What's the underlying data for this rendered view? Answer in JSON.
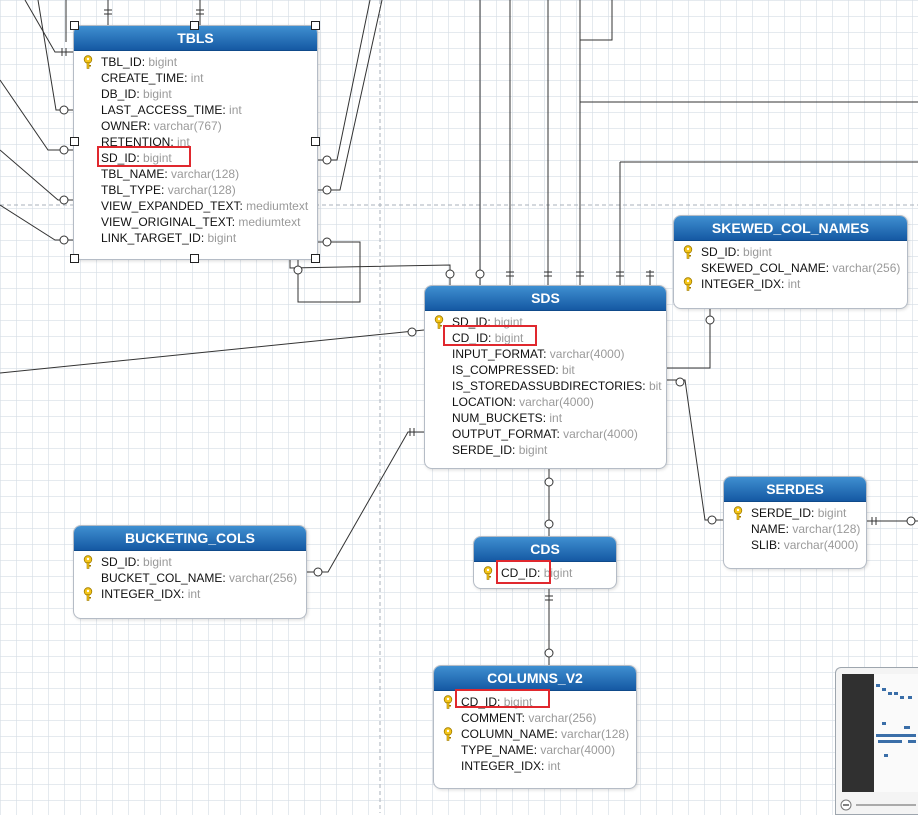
{
  "colors": {
    "header_top": "#3f8fd1",
    "header_bottom": "#1559a3",
    "highlight": "#e0282e",
    "type_text": "#9a9a9a",
    "key_icon": "#f5c518"
  },
  "entities": {
    "tbls": {
      "title": "TBLS",
      "rows": [
        {
          "name": "TBL_ID",
          "type": "bigint",
          "key": true
        },
        {
          "name": "CREATE_TIME",
          "type": "int"
        },
        {
          "name": "DB_ID",
          "type": "bigint"
        },
        {
          "name": "LAST_ACCESS_TIME",
          "type": "int"
        },
        {
          "name": "OWNER",
          "type": "varchar(767)"
        },
        {
          "name": "RETENTION",
          "type": "int"
        },
        {
          "name": "SD_ID",
          "type": "bigint"
        },
        {
          "name": "TBL_NAME",
          "type": "varchar(128)"
        },
        {
          "name": "TBL_TYPE",
          "type": "varchar(128)"
        },
        {
          "name": "VIEW_EXPANDED_TEXT",
          "type": "mediumtext"
        },
        {
          "name": "VIEW_ORIGINAL_TEXT",
          "type": "mediumtext"
        },
        {
          "name": "LINK_TARGET_ID",
          "type": "bigint"
        }
      ]
    },
    "sds": {
      "title": "SDS",
      "rows": [
        {
          "name": "SD_ID",
          "type": "bigint",
          "key": true
        },
        {
          "name": "CD_ID",
          "type": "bigint"
        },
        {
          "name": "INPUT_FORMAT",
          "type": "varchar(4000)"
        },
        {
          "name": "IS_COMPRESSED",
          "type": "bit"
        },
        {
          "name": "IS_STOREDASSUBDIRECTORIES",
          "type": "bit"
        },
        {
          "name": "LOCATION",
          "type": "varchar(4000)"
        },
        {
          "name": "NUM_BUCKETS",
          "type": "int"
        },
        {
          "name": "OUTPUT_FORMAT",
          "type": "varchar(4000)"
        },
        {
          "name": "SERDE_ID",
          "type": "bigint"
        }
      ]
    },
    "skewed_col_names": {
      "title": "SKEWED_COL_NAMES",
      "rows": [
        {
          "name": "SD_ID",
          "type": "bigint",
          "key": true
        },
        {
          "name": "SKEWED_COL_NAME",
          "type": "varchar(256)"
        },
        {
          "name": "INTEGER_IDX",
          "type": "int",
          "key": true
        }
      ]
    },
    "serdes": {
      "title": "SERDES",
      "rows": [
        {
          "name": "SERDE_ID",
          "type": "bigint",
          "key": true
        },
        {
          "name": "NAME",
          "type": "varchar(128)"
        },
        {
          "name": "SLIB",
          "type": "varchar(4000)"
        }
      ]
    },
    "bucketing_cols": {
      "title": "BUCKETING_COLS",
      "rows": [
        {
          "name": "SD_ID",
          "type": "bigint",
          "key": true
        },
        {
          "name": "BUCKET_COL_NAME",
          "type": "varchar(256)"
        },
        {
          "name": "INTEGER_IDX",
          "type": "int",
          "key": true
        }
      ]
    },
    "cds": {
      "title": "CDS",
      "rows": [
        {
          "name": "CD_ID",
          "type": "bigint",
          "key": true
        }
      ]
    },
    "columns_v2": {
      "title": "COLUMNS_V2",
      "rows": [
        {
          "name": "CD_ID",
          "type": "bigint",
          "key": true
        },
        {
          "name": "COMMENT",
          "type": "varchar(256)"
        },
        {
          "name": "COLUMN_NAME",
          "type": "varchar(128)",
          "key": true
        },
        {
          "name": "TYPE_NAME",
          "type": "varchar(4000)"
        },
        {
          "name": "INTEGER_IDX",
          "type": "int"
        }
      ]
    }
  }
}
